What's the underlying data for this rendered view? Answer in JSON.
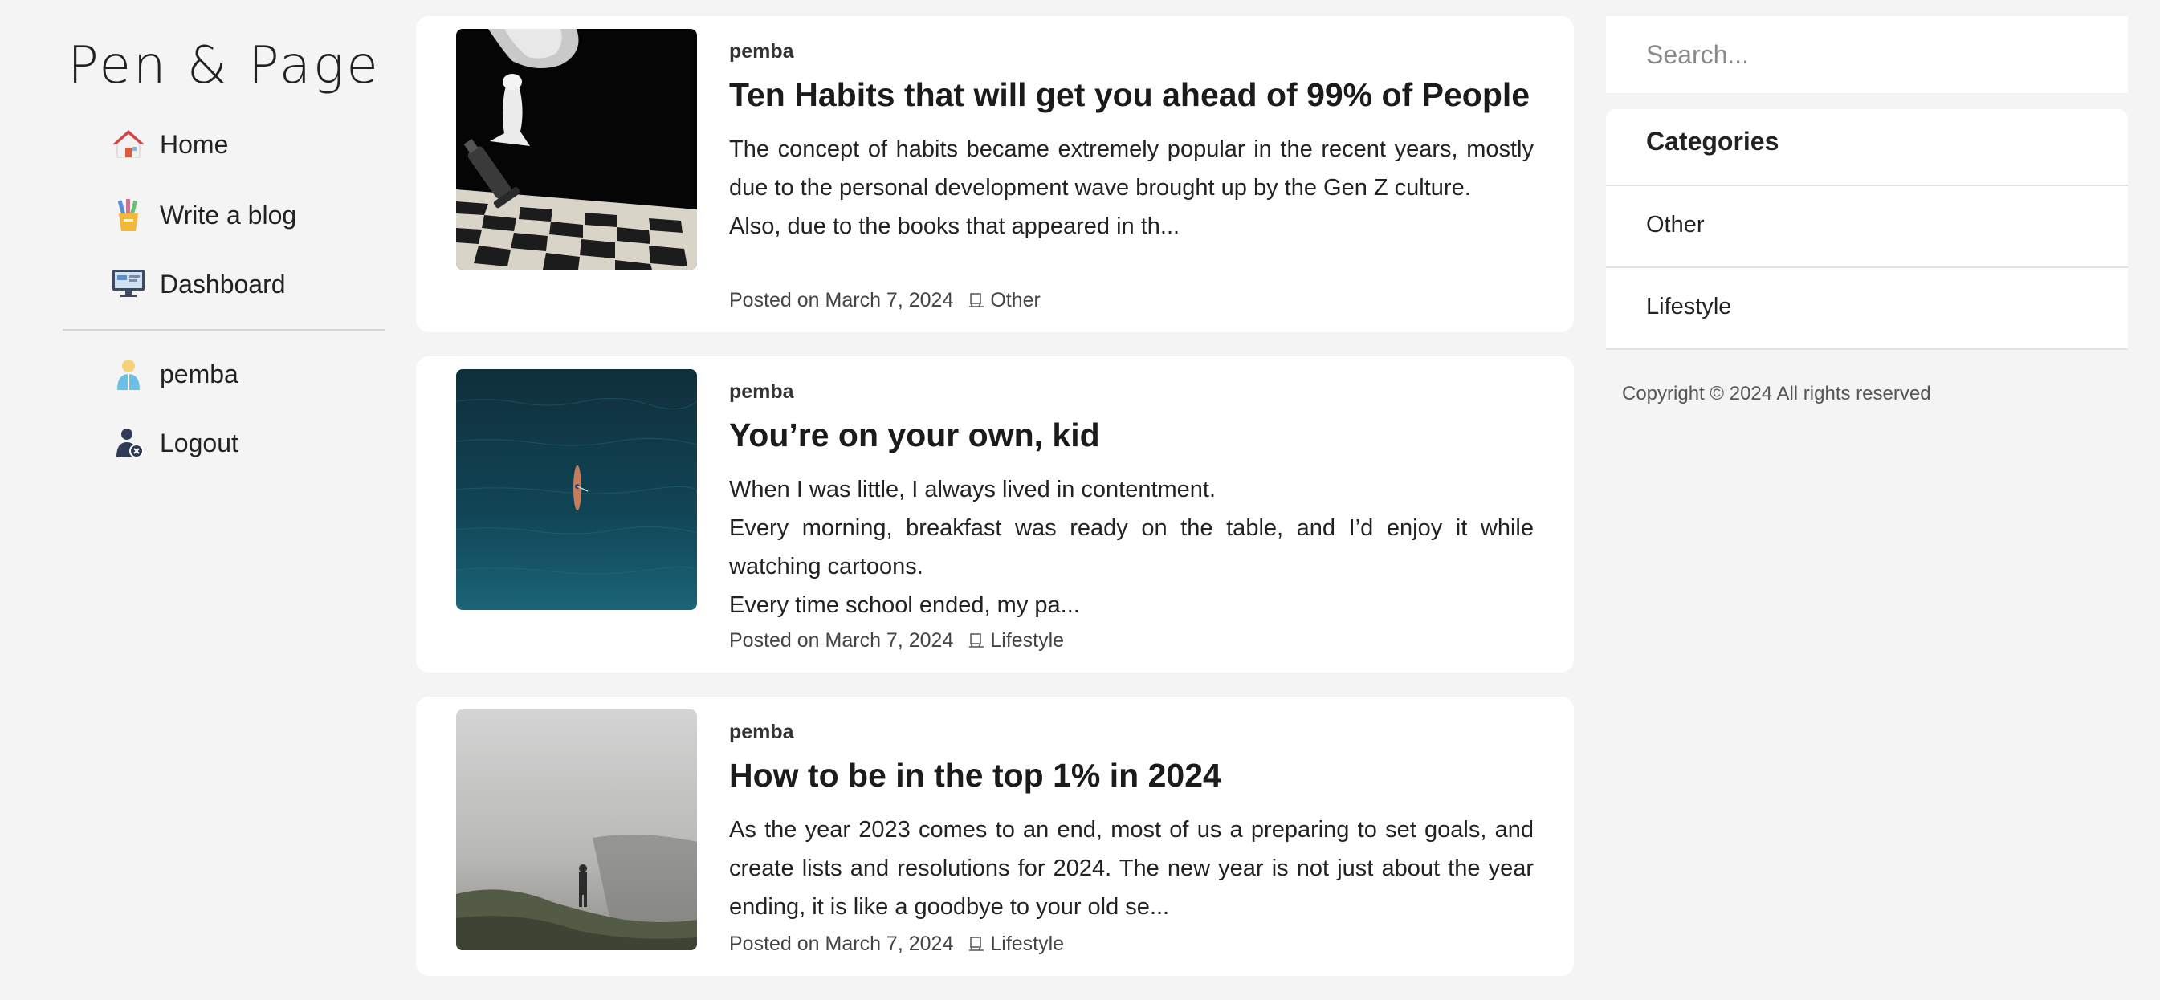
{
  "brand": {
    "logo_text": "Pen & Page"
  },
  "nav": {
    "home": "Home",
    "write": "Write a blog",
    "dashboard": "Dashboard",
    "user": "pemba",
    "logout": "Logout"
  },
  "posts": [
    {
      "author": "pemba",
      "title": "Ten Habits that will get you ahead of 99% of People",
      "excerpt_lines": [
        "The concept of habits became extremely popular in the recent years, mostly due to the personal development wave brought up by the Gen Z culture.",
        "Also, due to the books that appeared in th..."
      ],
      "posted": "Posted on March 7, 2024",
      "category": "Other",
      "image": "chess-pieces-photo"
    },
    {
      "author": "pemba",
      "title": "You’re on your own, kid",
      "excerpt_lines": [
        "When I was little, I always lived in contentment.",
        "Every morning, breakfast was ready on the table, and I’d enjoy it while watching cartoons.",
        "Every time school ended, my pa..."
      ],
      "posted": "Posted on March 7, 2024",
      "category": "Lifestyle",
      "image": "kayak-on-ocean-photo"
    },
    {
      "author": "pemba",
      "title": "How to be in the top 1% in 2024",
      "excerpt_lines": [
        "As the year 2023 comes to an end, most of us a preparing to set goals, and create lists and resolutions for 2024. The new year is not just about the year ending, it is like a goodbye to your old se..."
      ],
      "posted": "Posted on March 7, 2024",
      "category": "Lifestyle",
      "image": "person-in-fog-photo"
    }
  ],
  "search": {
    "placeholder": "Search..."
  },
  "categories": {
    "heading": "Categories",
    "items": [
      "Other",
      "Lifestyle"
    ]
  },
  "footer": {
    "copyright": "Copyright © 2024 All rights reserved"
  },
  "colors": {
    "page_bg": "#f4f4f4",
    "card_bg": "#ffffff",
    "text": "#222222",
    "divider": "#d6d6d6"
  },
  "icons": {
    "home": "house-icon",
    "write": "pencil-cup-icon",
    "dashboard": "monitor-icon",
    "user": "user-icon",
    "logout": "user-logout-icon",
    "category": "category-icon"
  }
}
